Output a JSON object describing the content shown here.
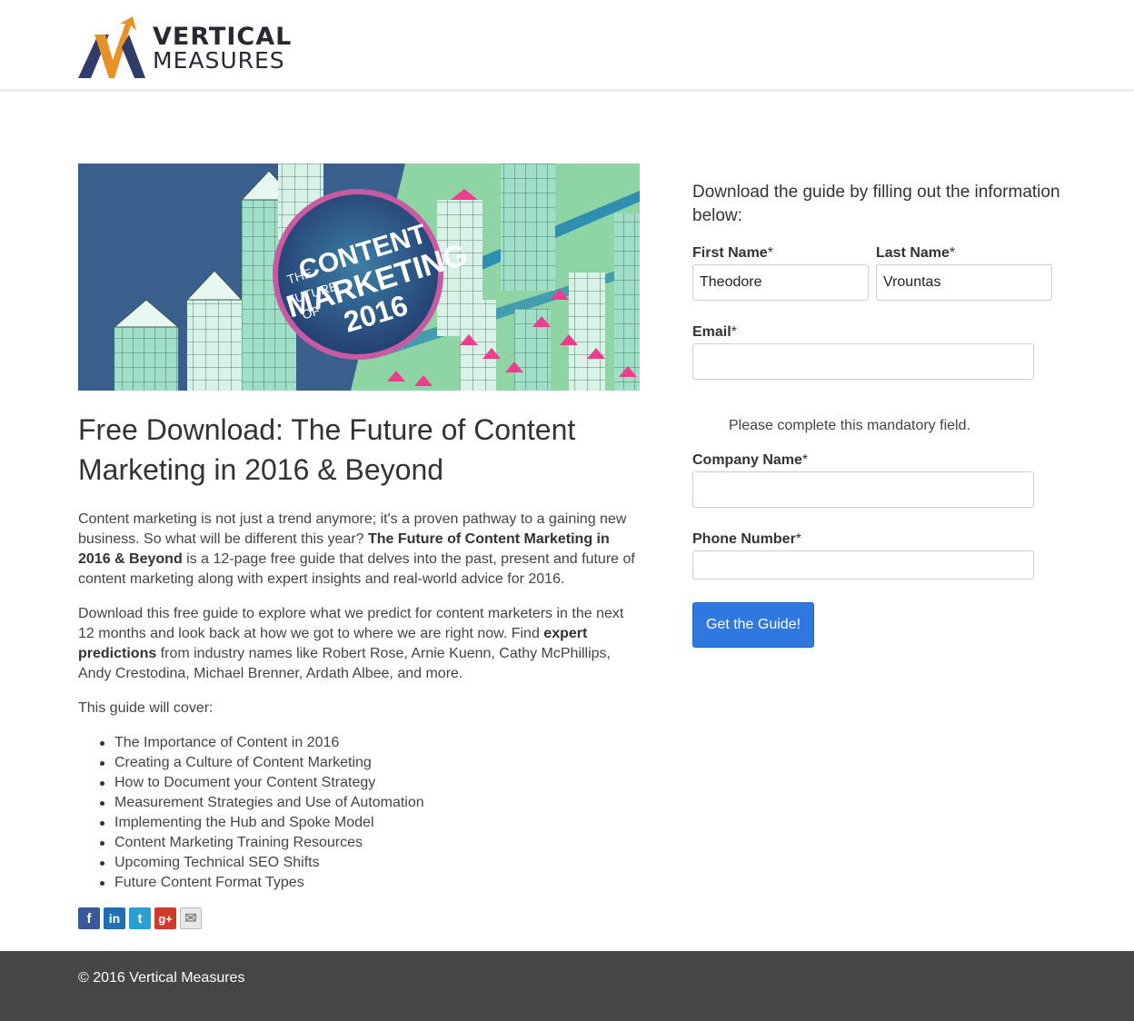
{
  "header": {
    "logo_line1": "VERTICAL",
    "logo_line2": "MEASURES"
  },
  "banner": {
    "line_the": "THE",
    "line_future": "FUTURE",
    "line_of": "OF",
    "line_content": "CONTENT",
    "line_marketing": "MARKETING",
    "line_year": "2016"
  },
  "main": {
    "title": "Free Download: The Future of Content Marketing in 2016 & Beyond",
    "p1_a": "Content marketing is not just a trend anymore; it's a proven pathway to a gaining new business. So what will be different this year? ",
    "p1_bold": "The Future of Content Marketing in 2016 & Beyond",
    "p1_b": " is a 12-page free guide that delves into the past, present and future of content marketing along with expert insights and real-world advice for 2016.",
    "p2_a": "Download this free guide to explore what we predict for content marketers in the next 12 months and look back at how we got to where we are right now. Find ",
    "p2_bold": "expert predictions",
    "p2_b": " from industry names like Robert Rose, Arnie Kuenn, Cathy McPhillips, Andy Crestodina, Michael Brenner, Ardath Albee, and more.",
    "p3": "This guide will cover:",
    "cover_items": [
      "The Importance of Content in 2016",
      "Creating a Culture of Content Marketing",
      "How to Document your Content Strategy",
      "Measurement Strategies and Use of Automation",
      "Implementing the Hub and Spoke Model",
      "Content Marketing Training Resources",
      "Upcoming Technical SEO Shifts",
      "Future Content Format Types"
    ],
    "share_icons": [
      {
        "name": "facebook-icon",
        "glyph": "f",
        "color": "#3b5998"
      },
      {
        "name": "linkedin-icon",
        "glyph": "in",
        "color": "#1f6fb2"
      },
      {
        "name": "twitter-icon",
        "glyph": "t",
        "color": "#2a9fd6"
      },
      {
        "name": "google-plus-icon",
        "glyph": "g+",
        "color": "#d13a2b"
      },
      {
        "name": "email-icon",
        "glyph": "✉",
        "color": "#e8e8e8"
      }
    ]
  },
  "form": {
    "intro": "Download the guide by filling out the information below:",
    "first_name_label": "First Name",
    "first_name_value": "Theodore",
    "last_name_label": "Last Name",
    "last_name_value": "Vrountas",
    "email_label": "Email",
    "email_value": "",
    "email_hint": "Please complete this mandatory field.",
    "company_label": "Company Name",
    "company_value": "",
    "phone_label": "Phone Number",
    "phone_value": "",
    "required_marker": "*",
    "submit_label": "Get the Guide!"
  },
  "footer": {
    "copyright": "© 2016 Vertical Measures"
  },
  "colors": {
    "accent_blue": "#2e78df",
    "footer_bg": "#464646",
    "logo_orange": "#e8912a",
    "logo_navy": "#2f3b6b"
  }
}
